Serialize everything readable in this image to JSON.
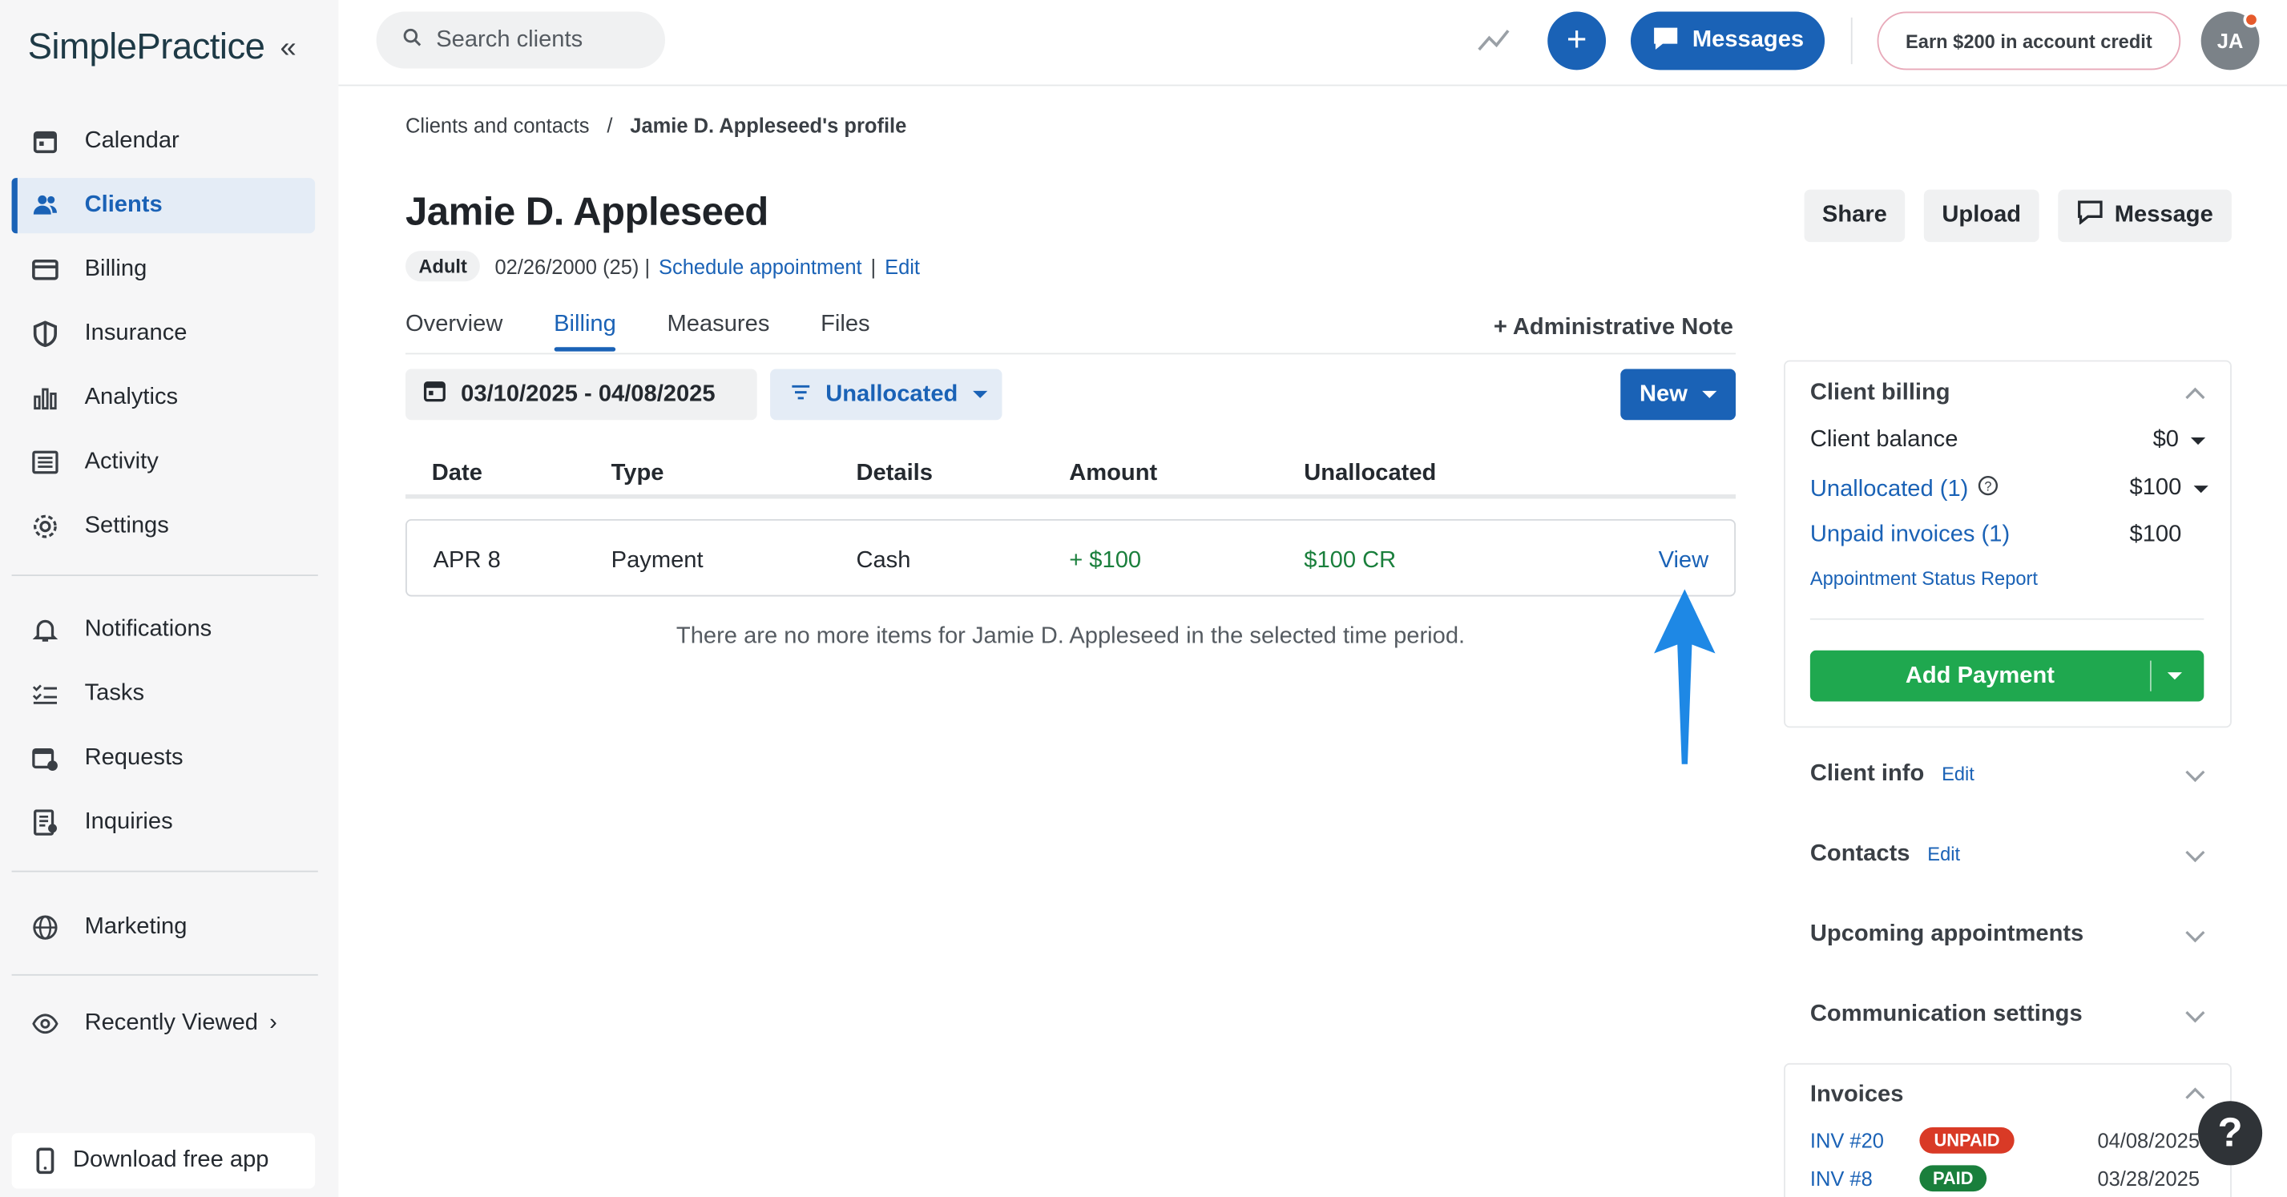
{
  "sidebar": {
    "logo": "SimplePractice",
    "nav": [
      {
        "label": "Calendar",
        "icon": "calendar-icon"
      },
      {
        "label": "Clients",
        "icon": "users-icon",
        "active": true
      },
      {
        "label": "Billing",
        "icon": "credit-card-icon"
      },
      {
        "label": "Insurance",
        "icon": "shield-icon"
      },
      {
        "label": "Analytics",
        "icon": "bar-chart-icon"
      },
      {
        "label": "Activity",
        "icon": "list-icon"
      },
      {
        "label": "Settings",
        "icon": "gear-icon"
      }
    ],
    "nav2": [
      {
        "label": "Notifications",
        "icon": "bell-icon"
      },
      {
        "label": "Tasks",
        "icon": "checklist-icon"
      },
      {
        "label": "Requests",
        "icon": "calendar-plus-icon"
      },
      {
        "label": "Inquiries",
        "icon": "document-icon"
      }
    ],
    "marketing": "Marketing",
    "recently_viewed": "Recently Viewed",
    "download_app": "Download free app"
  },
  "header": {
    "search_placeholder": "Search clients",
    "messages_label": "Messages",
    "credit_label": "Earn $200 in account credit",
    "avatar_initials": "JA"
  },
  "breadcrumb": {
    "parent": "Clients and contacts",
    "separator": "/",
    "current": "Jamie D. Appleseed's profile"
  },
  "client": {
    "name": "Jamie D. Appleseed",
    "badge": "Adult",
    "dob": "02/26/2000 (25) |",
    "schedule_link": "Schedule appointment",
    "pipe": "|",
    "edit_link": "Edit"
  },
  "actions": {
    "share": "Share",
    "upload": "Upload",
    "message": "Message"
  },
  "tabs": [
    "Overview",
    "Billing",
    "Measures",
    "Files"
  ],
  "admin_note": "+ Administrative Note",
  "filters": {
    "date_range": "03/10/2025 - 04/08/2025",
    "filter": "Unallocated",
    "new_label": "New"
  },
  "table": {
    "headers": [
      "Date",
      "Type",
      "Details",
      "Amount",
      "Unallocated"
    ],
    "rows": [
      {
        "date": "APR 8",
        "type": "Payment",
        "details": "Cash",
        "amount": "+ $100",
        "unallocated": "$100 CR",
        "action": "View"
      }
    ],
    "empty_message": "There are no more items for Jamie D. Appleseed in the selected time period."
  },
  "client_billing": {
    "title": "Client billing",
    "balance_label": "Client balance",
    "balance_value": "$0",
    "unallocated_label": "Unallocated (1)",
    "unallocated_value": "$100",
    "unpaid_label": "Unpaid invoices (1)",
    "unpaid_value": "$100",
    "report_link": "Appointment Status Report",
    "add_payment": "Add Payment"
  },
  "sections": {
    "client_info": "Client info",
    "contacts": "Contacts",
    "edit": "Edit",
    "upcoming": "Upcoming appointments",
    "communication": "Communication settings",
    "invoices": "Invoices"
  },
  "invoices": [
    {
      "number": "INV #20",
      "status": "UNPAID",
      "date": "04/08/2025",
      "color": "#d93a26"
    },
    {
      "number": "INV #8",
      "status": "PAID",
      "date": "03/28/2025",
      "color": "#1a7f3c"
    }
  ],
  "help_label": "?",
  "colors": {
    "primary": "#1a62b6",
    "success": "#1fa84f",
    "danger": "#d93a26",
    "sidebar_bg": "#f6f6f7"
  }
}
